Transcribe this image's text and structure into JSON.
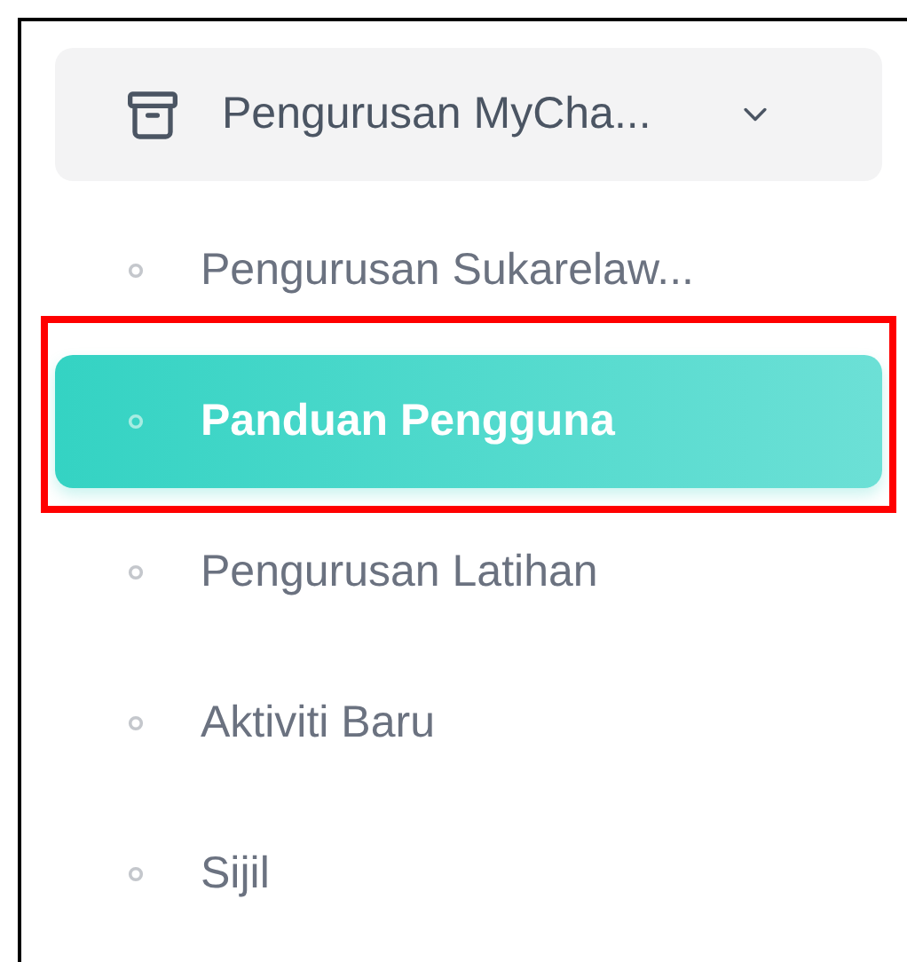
{
  "menu_group": {
    "label": "Pengurusan MyCha...",
    "expanded": true
  },
  "items": [
    {
      "label": "Pengurusan Sukarelaw...",
      "selected": false,
      "highlighted": false
    },
    {
      "label": "Panduan Pengguna",
      "selected": true,
      "highlighted": true
    },
    {
      "label": "Pengurusan Latihan",
      "selected": false,
      "highlighted": false
    },
    {
      "label": "Aktiviti Baru",
      "selected": false,
      "highlighted": false
    },
    {
      "label": "Sijil",
      "selected": false,
      "highlighted": false
    }
  ]
}
